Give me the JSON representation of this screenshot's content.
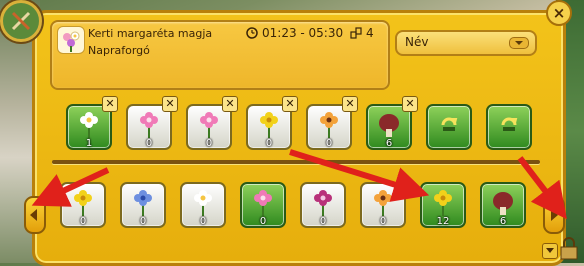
{
  "dialog": {
    "close_label": "×",
    "garden": {
      "title": "Kerti margaréta magja",
      "subtitle": "Napraforgó",
      "time_range": "01:23 - 05:30",
      "seed_count": "4"
    },
    "sort": {
      "selected": "Név"
    }
  },
  "selected_slots": [
    {
      "name": "white-daisy",
      "count": "1",
      "active": true,
      "removable": true
    },
    {
      "name": "pink-foxglove",
      "count": "0",
      "active": false,
      "removable": true
    },
    {
      "name": "pink-bloom",
      "count": "0",
      "active": false,
      "removable": true
    },
    {
      "name": "yellow-primrose",
      "count": "0",
      "active": false,
      "removable": true
    },
    {
      "name": "orchid",
      "count": "0",
      "active": false,
      "removable": true
    },
    {
      "name": "mushroom",
      "count": "6",
      "active": true,
      "removable": true
    },
    {
      "name": "empty-slot-1",
      "count": "",
      "active": true,
      "removable": false
    },
    {
      "name": "empty-slot-2",
      "count": "",
      "active": true,
      "removable": false
    }
  ],
  "inventory": [
    {
      "name": "yellow-buttercup",
      "count": "0",
      "active": false
    },
    {
      "name": "blue-cornflower",
      "count": "0",
      "active": false
    },
    {
      "name": "white-babysbreath",
      "count": "0",
      "active": false
    },
    {
      "name": "pink-daisy",
      "count": "0",
      "active": true
    },
    {
      "name": "magenta-snapdragon",
      "count": "0",
      "active": false
    },
    {
      "name": "orange-lily",
      "count": "0",
      "active": false
    },
    {
      "name": "yellow-daffodil",
      "count": "12",
      "active": true
    },
    {
      "name": "mushroom-red",
      "count": "6",
      "active": true
    }
  ],
  "icons": {
    "clock": "clock-icon",
    "seeds": "seed-icon",
    "settings": "garden-tools-icon"
  },
  "colors": {
    "panel": "#f3c31a",
    "slot_active": "#5aa83a",
    "annotation_arrow": "#e0211b"
  }
}
